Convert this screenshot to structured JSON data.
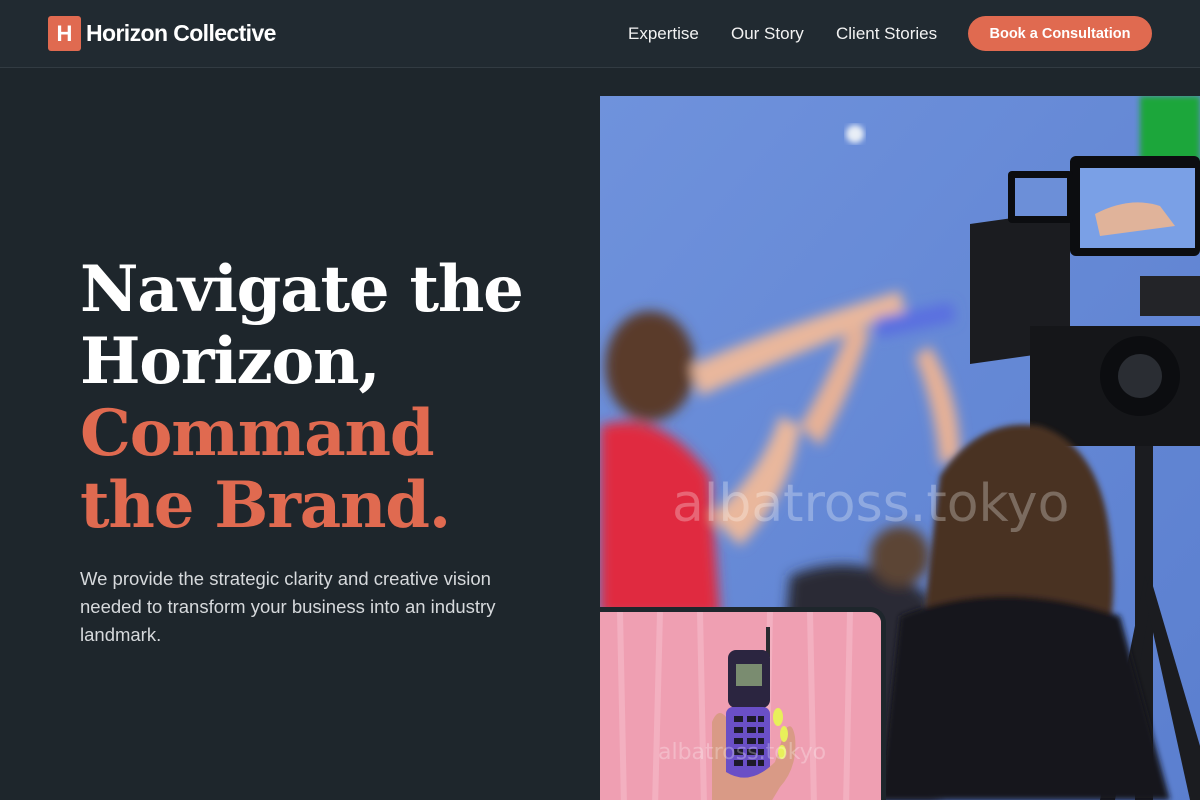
{
  "brand": {
    "mark": "H",
    "name": "Horizon Collective"
  },
  "nav": {
    "links": [
      "Expertise",
      "Our Story",
      "Client Stories"
    ],
    "cta": "Book a Consultation"
  },
  "hero": {
    "headline_lines": [
      "Navigate the",
      "Horizon,"
    ],
    "headline_accent_lines": [
      "Command",
      "the Brand."
    ],
    "subtext": "We provide the strategic clarity and creative vision needed to transform your business into an industry landmark."
  },
  "images": {
    "main_watermark": "albatross.tokyo",
    "small_watermark": "albatross.tokyo"
  },
  "colors": {
    "accent": "#e06a50",
    "background": "#1e262c",
    "nav_bg": "#212a31"
  }
}
